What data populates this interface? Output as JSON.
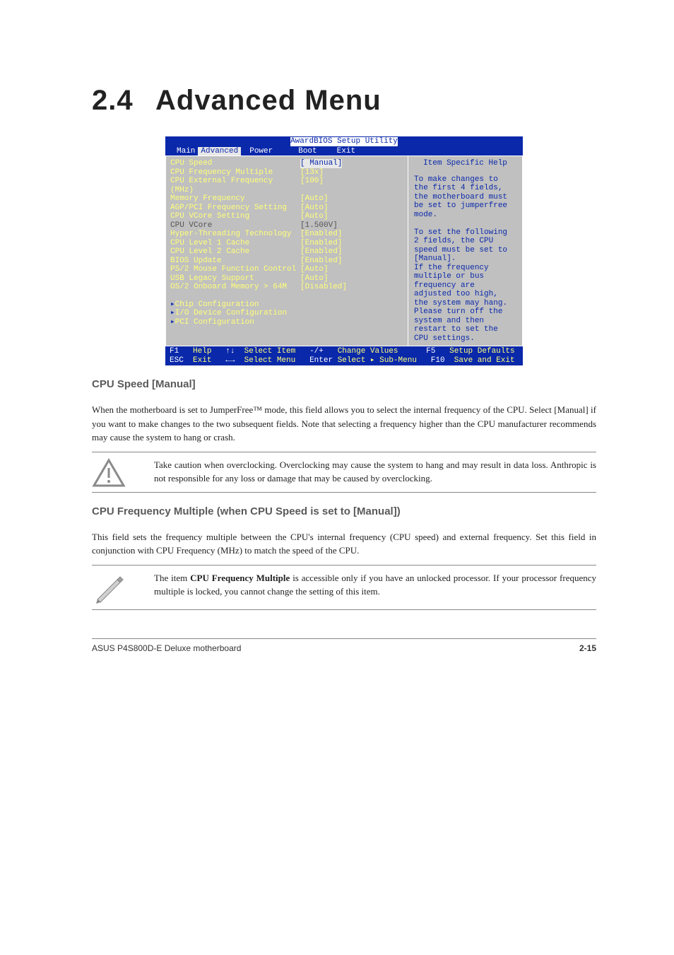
{
  "heading": {
    "num": "2.4",
    "title": "Advanced Menu"
  },
  "bios": {
    "title": "AwardBIOS Setup Utility",
    "tabs": [
      "Main",
      "Advanced",
      "Power",
      "Boot",
      "Exit"
    ],
    "items": [
      {
        "label": "CPU Speed",
        "value": "[ Manual]",
        "sel": true
      },
      {
        "label": "CPU Frequency Multiple",
        "value": "[13x]"
      },
      {
        "label": "CPU External Frequency (MHz)",
        "value": "[100]"
      },
      {
        "label": "Memory Frequency",
        "value": "[Auto]"
      },
      {
        "label": "AGP/PCI Frequency Setting",
        "value": "[Auto]"
      },
      {
        "label": "CPU VCore Setting",
        "value": "[Auto]"
      },
      {
        "label": "CPU VCore",
        "value": "[1.500V]",
        "dim": true
      },
      {
        "label": "Hyper-Threading Technology",
        "value": "[Enabled]"
      },
      {
        "label": "CPU Level 1 Cache",
        "value": "[Enabled]"
      },
      {
        "label": "CPU Level 2 Cache",
        "value": "[Enabled]"
      },
      {
        "label": "BIOS Update",
        "value": "[Enabled]"
      },
      {
        "label": "PS/2 Mouse Function Control",
        "value": "[Auto]"
      },
      {
        "label": "USB Legacy Support",
        "value": "[Auto]"
      },
      {
        "label": "OS/2 Onboard Memory > 64M",
        "value": "[Disabled]"
      }
    ],
    "subs": [
      "Chip Configuration",
      "I/O Device Configuration",
      "PCI Configuration"
    ],
    "help_title": "Item Specific Help",
    "help_text": "To make changes to the first 4 fields, the motherboard must be set to jumperfree mode.\n\nTo set the following 2 fields, the CPU speed must be set to [Manual].\nIf the frequency multiple or bus frequency are adjusted too high, the system may hang. Please turn off the system and then restart to set the CPU settings.",
    "footer": [
      {
        "k": "F1",
        "a": "Help"
      },
      {
        "k": "↑↓",
        "a": "Select Item"
      },
      {
        "k": "-/+",
        "a": "Change Values"
      },
      {
        "k": "F5",
        "a": "Setup Defaults"
      },
      {
        "k": "ESC",
        "a": "Exit"
      },
      {
        "k": "←→",
        "a": "Select Menu"
      },
      {
        "k": "Enter",
        "a": "Select ▸ Sub-Menu"
      },
      {
        "k": "F10",
        "a": "Save and Exit"
      }
    ]
  },
  "sections": {
    "cpu_speed": {
      "title": "CPU Speed [Manual]",
      "text": "When the motherboard is set to JumperFree™ mode, this field allows you to select the internal frequency of the CPU. Select [Manual] if you want to make changes to the two subsequent fields. Note that selecting a frequency higher than the CPU manufacturer recommends may cause the system to hang or crash."
    },
    "caution": "Take caution when overclocking. Overclocking may cause the system to hang and may result in data loss. Anthropic is not responsible for any loss or damage that may be caused by overclocking.",
    "cpu_mult": {
      "title": "CPU Frequency Multiple (when CPU Speed is set to [Manual])",
      "text": "This field sets the frequency multiple between the CPU's internal frequency (CPU speed) and external frequency. Set this field in conjunction with CPU Frequency (MHz) to match the speed of the CPU."
    },
    "note": "The item CPU Frequency Multiple is accessible only if you have an unlocked processor. If your processor frequency multiple is locked, you cannot change the setting of this item."
  },
  "footer": {
    "left": "ASUS P4S800D-E Deluxe motherboard",
    "right": "2-15"
  }
}
